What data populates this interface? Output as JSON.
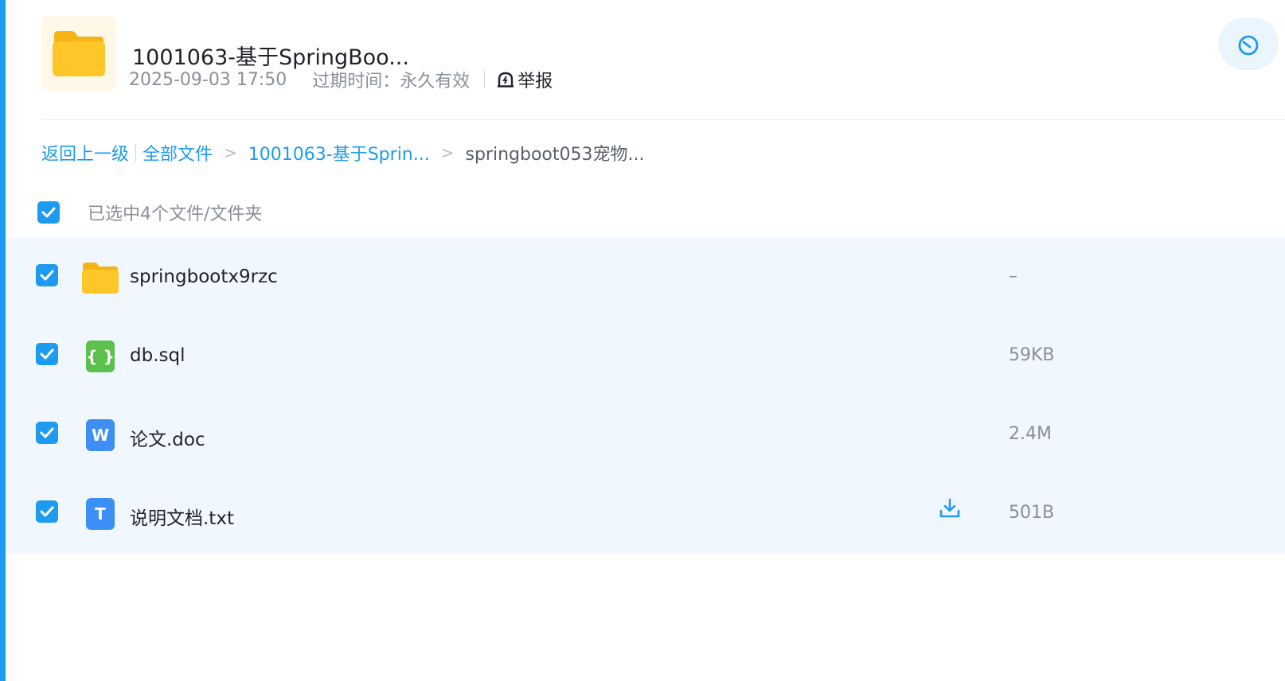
{
  "header": {
    "title": "1001063-基于SpringBoo...",
    "date": "2025-09-03 17:50",
    "expire": "过期时间：永久有效",
    "report": "举报"
  },
  "breadcrumb": {
    "back": "返回上一级",
    "all": "全部文件",
    "arrow": ">",
    "level1": "1001063-基于Sprin...",
    "current": "springboot053宠物..."
  },
  "selection": {
    "text": "已选中4个文件/文件夹"
  },
  "files": [
    {
      "name": "springbootx9rzc",
      "size": "–",
      "icon": "folder-icon"
    },
    {
      "name": "db.sql",
      "size": "59KB",
      "icon": "sql-file-icon",
      "glyph": "{ }"
    },
    {
      "name": "论文.doc",
      "size": "2.4M",
      "icon": "word-file-icon",
      "glyph": "W"
    },
    {
      "name": "说明文档.txt",
      "size": "501B",
      "icon": "text-file-icon",
      "glyph": "T"
    }
  ],
  "colors": {
    "accent": "#1e9bf0",
    "row_bg": "#f0f7fe",
    "folder": "#ffc629"
  }
}
